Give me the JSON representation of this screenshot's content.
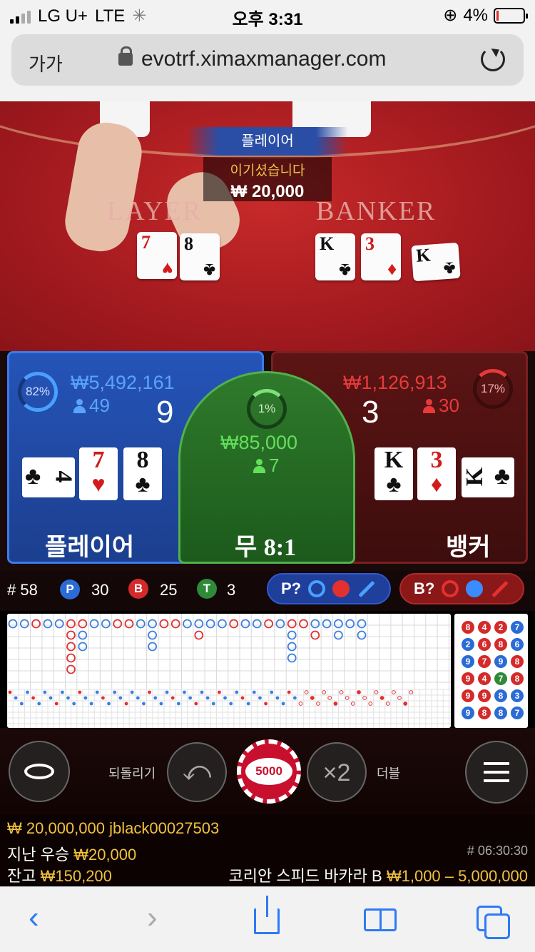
{
  "status_bar": {
    "carrier": "LG U+",
    "network": "LTE",
    "time": "오후 3:31",
    "battery": "4%"
  },
  "browser": {
    "text_size": "가가",
    "url": "evotrf.ximaxmanager.com"
  },
  "table": {
    "felt_player": "LAYER",
    "felt_banker": "BANKER",
    "result_banner": "플레이어",
    "win_message": "이기셨습니다",
    "win_amount": "₩ 20,000",
    "player_cards": [
      {
        "rank": "7",
        "suit": "♥"
      },
      {
        "rank": "8",
        "suit": "♣"
      }
    ],
    "banker_cards": [
      {
        "rank": "K",
        "suit": "♣"
      },
      {
        "rank": "3",
        "suit": "♦"
      },
      {
        "rank": "K",
        "suit": "♣"
      }
    ]
  },
  "bets": {
    "player": {
      "percent": "82%",
      "percent_value": 82,
      "amount": "₩5,492,161",
      "users": "49",
      "score": "9",
      "label": "플레이어",
      "cards": [
        {
          "rank": "4",
          "suit": "♣",
          "rotated": true
        },
        {
          "rank": "7",
          "suit": "♥"
        },
        {
          "rank": "8",
          "suit": "♣"
        }
      ]
    },
    "tie": {
      "percent": "1%",
      "percent_value": 1,
      "amount": "₩85,000",
      "users": "7",
      "label": "무",
      "payout": "8:1"
    },
    "banker": {
      "percent": "17%",
      "percent_value": 17,
      "amount": "₩1,126,913",
      "users": "30",
      "score": "3",
      "label": "뱅커",
      "cards": [
        {
          "rank": "K",
          "suit": "♣"
        },
        {
          "rank": "3",
          "suit": "♦"
        },
        {
          "rank": "K",
          "suit": "♣",
          "rotated": true
        }
      ]
    }
  },
  "stats": {
    "round": "# 58",
    "p_label": "P",
    "p_count": "30",
    "b_label": "B",
    "b_count": "25",
    "t_label": "T",
    "t_count": "3",
    "player_predict": "P?",
    "banker_predict": "B?"
  },
  "road_beads": [
    [
      "8",
      "4",
      "2",
      "7"
    ],
    [
      "2",
      "6",
      "8",
      "6"
    ],
    [
      "9",
      "7",
      "9",
      "8"
    ],
    [
      "9",
      "4",
      "7",
      "8"
    ],
    [
      "9",
      "9",
      "8",
      "3"
    ],
    [
      "9",
      "8",
      "8",
      "7"
    ]
  ],
  "controls": {
    "undo_label": "되돌리기",
    "chip_value": "5000",
    "double_symbol": "×2",
    "double_label": "더블"
  },
  "info": {
    "line1": "₩ 20,000,000 jblack00027503",
    "last_win_label": "지난 우승",
    "last_win": "₩20,000",
    "game_id": "# 06:30:30",
    "balance_label": "잔고",
    "balance": "₩150,200",
    "table_name": "코리안 스피드 바카라 B",
    "limits": "₩1,000 – 5,000,000"
  },
  "colors": {
    "player": "#2554b8",
    "banker": "#8e1a1a",
    "tie": "#2f7a2c",
    "gold": "#f2c23e"
  }
}
